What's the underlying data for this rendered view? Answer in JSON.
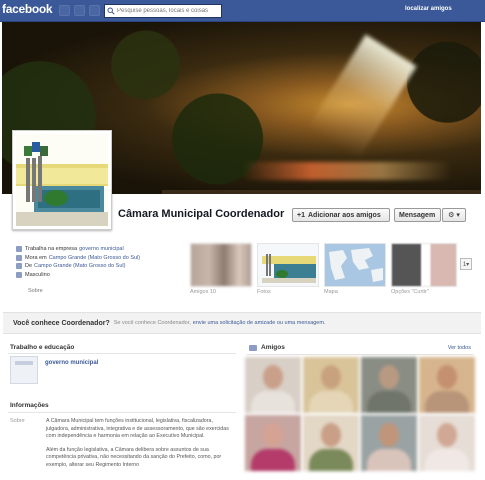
{
  "topbar": {
    "logo": "facebook",
    "search_placeholder": "Pesquise pessoas, locais e coisas",
    "find_friends": "localizar amigos"
  },
  "profile": {
    "name": "Câmara Municipal Coordenador",
    "add_friend_label": "Adicionar aos amigos",
    "message_label": "Mensagem",
    "gear_label": "⚙ ▾"
  },
  "info": {
    "items": [
      {
        "text": "Trabalha na empresa",
        "link": "governo municipal"
      },
      {
        "text": "Mora em",
        "link": "Campo Grande (Mato Grosso do Sul)"
      },
      {
        "text": "De",
        "link": "Campo Grande (Mato Grosso do Sul)"
      },
      {
        "text": "Masculino",
        "link": ""
      }
    ],
    "about_label": "Sobre"
  },
  "thumbnails": [
    {
      "label": "Amigos 10"
    },
    {
      "label": "Fotos"
    },
    {
      "label": "Mapa"
    },
    {
      "label": "Opções \"Curtir\""
    }
  ],
  "scroll_arrow": "1▾",
  "know_bar": {
    "question": "Você conhece Coordenador?",
    "text": "Se você conhece Coordenador,",
    "link": "envie uma solicitação de amizade ou uma mensagem."
  },
  "work": {
    "title": "Trabalho e educação",
    "employer": "governo municipal"
  },
  "infos": {
    "title": "Informações",
    "sobre_label": "Sobre",
    "paragraphs": [
      "A Câmara Municipal tem funções institucional, legislativa, fiscalizadora, julgadora, administrativa, integrativa e de assessoramento, que são exercidas com independência e harmonia em relação ao Executivo Municipal.",
      "Além da função legislativa, a Câmara delibera sobre assuntos de sua competência privativa, não necessitando da sanção do Prefeito, como, por exemplo, alterar seu Regimento Interno"
    ]
  },
  "friends": {
    "title": "Amigos",
    "see_all": "Ver todos",
    "tiles": [
      {
        "bg": "#d8cfc6",
        "head": "#c9a08a",
        "body": "#e8e2dc"
      },
      {
        "bg": "#d9c49a",
        "head": "#c8a27e",
        "body": "#e4d6b6"
      },
      {
        "bg": "#8a8d84",
        "head": "#b89a82",
        "body": "#6f756b"
      },
      {
        "bg": "#d6b58e",
        "head": "#c49070",
        "body": "#b89478"
      },
      {
        "bg": "#c7a5a0",
        "head": "#d4a394",
        "body": "#b43b6a"
      },
      {
        "bg": "#e3d7c6",
        "head": "#c99f86",
        "body": "#7b8a5a"
      },
      {
        "bg": "#9aa3a3",
        "head": "#c0957a",
        "body": "#d9c4bb"
      },
      {
        "bg": "#e6ddd6",
        "head": "#d1a895",
        "body": "#f0e8e4"
      }
    ]
  },
  "colors": {
    "brand": "#3b5998",
    "link": "#3b5998"
  }
}
